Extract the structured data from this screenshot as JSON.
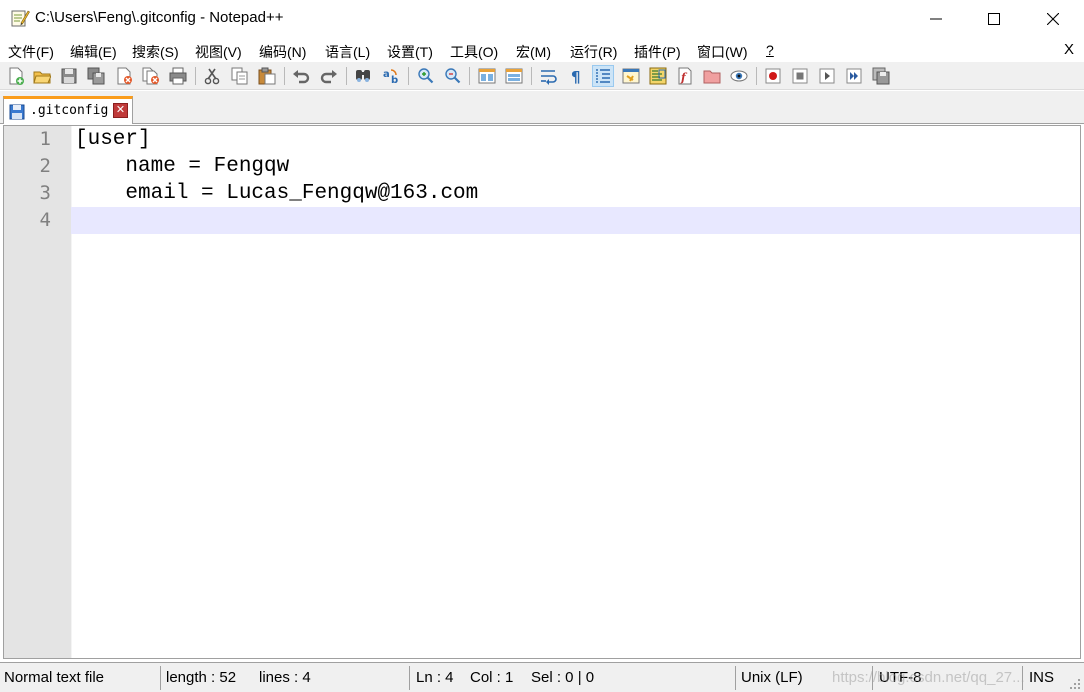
{
  "window": {
    "title": "C:\\Users\\Feng\\.gitconfig - Notepad++"
  },
  "menu": {
    "items": [
      "文件(F)",
      "编辑(E)",
      "搜索(S)",
      "视图(V)",
      "编码(N)",
      "语言(L)",
      "设置(T)",
      "工具(O)",
      "宏(M)",
      "运行(R)",
      "插件(P)",
      "窗口(W)",
      "?"
    ],
    "close_label": "X"
  },
  "toolbar": {
    "icons": [
      "new-file-icon",
      "open-file-icon",
      "save-icon",
      "save-all-icon",
      "close-icon",
      "close-all-icon",
      "print-icon",
      "cut-icon",
      "copy-icon",
      "paste-icon",
      "undo-icon",
      "redo-icon",
      "find-icon",
      "replace-icon",
      "zoom-in-icon",
      "zoom-out-icon",
      "sync-vertical-icon",
      "sync-horizontal-icon",
      "word-wrap-icon",
      "show-all-chars-icon",
      "indent-guide-icon",
      "user-language-icon",
      "document-map-icon",
      "function-list-icon",
      "folder-workspace-icon",
      "monitoring-icon",
      "record-macro-icon",
      "stop-record-icon",
      "play-macro-icon",
      "run-macro-multiple-icon",
      "save-macro-icon"
    ]
  },
  "tab": {
    "label": ".gitconfig",
    "close": "✕"
  },
  "editor": {
    "lines": [
      {
        "number": "1",
        "text": "[user]"
      },
      {
        "number": "2",
        "text": "    name = Fengqw"
      },
      {
        "number": "3",
        "text": "    email = Lucas_Fengqw@163.com"
      },
      {
        "number": "4",
        "text": ""
      }
    ],
    "current_line": 4
  },
  "status": {
    "file_type": "Normal text file",
    "length": "length : 52",
    "lines": "lines : 4",
    "ln": "Ln : 4",
    "col": "Col : 1",
    "sel": "Sel : 0 | 0",
    "eol": "Unix (LF)",
    "encoding": "UTF-8",
    "mode": "INS",
    "watermark": "https://blog.csdn.net/qq_27..."
  },
  "colors": {
    "tab_accent": "#fa9c1b",
    "current_line": "#e8e8ff",
    "gutter": "#e4e4e4",
    "line_number": "#808080"
  }
}
